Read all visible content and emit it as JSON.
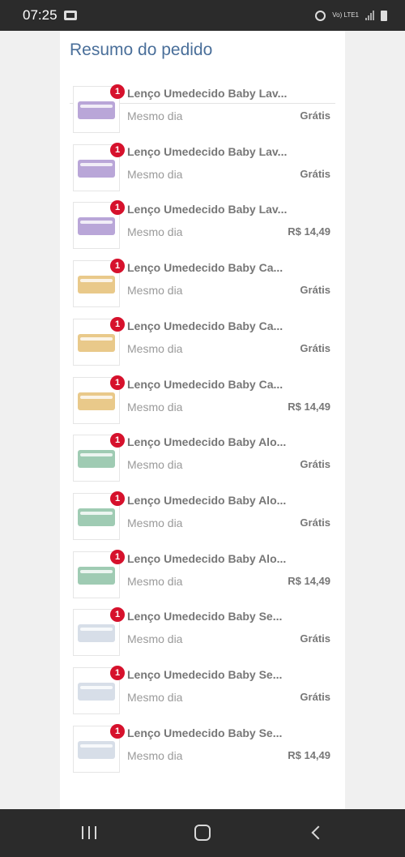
{
  "status_bar": {
    "time": "07:25",
    "network": "Vo) LTE1"
  },
  "order_summary": {
    "title": "Resumo do pedido",
    "items": [
      {
        "name": "Lenço Umedecido Baby Lav...",
        "delivery": "Mesmo dia",
        "price": "Grátis",
        "qty": "1",
        "pack_color": "#b9a6d8"
      },
      {
        "name": "Lenço Umedecido Baby Lav...",
        "delivery": "Mesmo dia",
        "price": "Grátis",
        "qty": "1",
        "pack_color": "#b9a6d8"
      },
      {
        "name": "Lenço Umedecido Baby Lav...",
        "delivery": "Mesmo dia",
        "price": "R$ 14,49",
        "qty": "1",
        "pack_color": "#b9a6d8"
      },
      {
        "name": "Lenço Umedecido Baby Ca...",
        "delivery": "Mesmo dia",
        "price": "Grátis",
        "qty": "1",
        "pack_color": "#e9c98a"
      },
      {
        "name": "Lenço Umedecido Baby Ca...",
        "delivery": "Mesmo dia",
        "price": "Grátis",
        "qty": "1",
        "pack_color": "#e9c98a"
      },
      {
        "name": "Lenço Umedecido Baby Ca...",
        "delivery": "Mesmo dia",
        "price": "R$ 14,49",
        "qty": "1",
        "pack_color": "#e9c98a"
      },
      {
        "name": "Lenço Umedecido Baby Alo...",
        "delivery": "Mesmo dia",
        "price": "Grátis",
        "qty": "1",
        "pack_color": "#9fcbb3"
      },
      {
        "name": "Lenço Umedecido Baby Alo...",
        "delivery": "Mesmo dia",
        "price": "Grátis",
        "qty": "1",
        "pack_color": "#9fcbb3"
      },
      {
        "name": "Lenço Umedecido Baby Alo...",
        "delivery": "Mesmo dia",
        "price": "R$ 14,49",
        "qty": "1",
        "pack_color": "#9fcbb3"
      },
      {
        "name": "Lenço Umedecido Baby Se...",
        "delivery": "Mesmo dia",
        "price": "Grátis",
        "qty": "1",
        "pack_color": "#d7dee8"
      },
      {
        "name": "Lenço Umedecido Baby Se...",
        "delivery": "Mesmo dia",
        "price": "Grátis",
        "qty": "1",
        "pack_color": "#d7dee8"
      },
      {
        "name": "Lenço Umedecido Baby Se...",
        "delivery": "Mesmo dia",
        "price": "R$ 14,49",
        "qty": "1",
        "pack_color": "#d7dee8"
      }
    ]
  },
  "nav_bar": {
    "recent_icon": "recent-apps-icon",
    "home_icon": "home-icon",
    "back_icon": "back-icon"
  }
}
